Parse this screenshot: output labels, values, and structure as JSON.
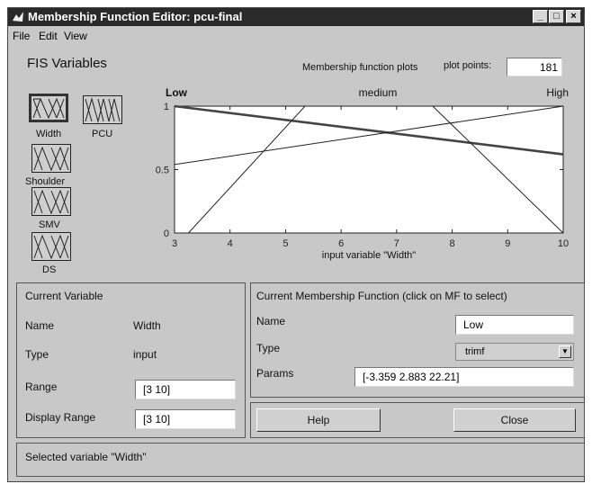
{
  "window": {
    "title": "Membership Function Editor: pcu-final",
    "minimize": "_",
    "maximize": "□",
    "close": "×"
  },
  "menu": [
    "File",
    "Edit",
    "View"
  ],
  "fis": {
    "label": "FIS Variables",
    "variables": [
      {
        "name": "Width",
        "selected": true
      },
      {
        "name": "PCU",
        "selected": false
      },
      {
        "name": "Shoulder",
        "selected": false
      },
      {
        "name": "SMV",
        "selected": false
      },
      {
        "name": "DS",
        "selected": false
      }
    ]
  },
  "plot": {
    "title_label": "Membership function plots",
    "points_label": "plot points:",
    "points_value": "181"
  },
  "chart_data": {
    "type": "line",
    "xlabel": "input variable \"Width\"",
    "xlim": [
      3,
      10
    ],
    "ylim": [
      0,
      1
    ],
    "xticks": [
      "3",
      "4",
      "5",
      "6",
      "7",
      "8",
      "9",
      "10"
    ],
    "yticks": [
      "0",
      "0.5",
      "1"
    ],
    "series": [
      {
        "name": "Low",
        "points": [
          [
            3,
            1
          ],
          [
            10,
            0.62
          ]
        ],
        "bold": true
      },
      {
        "name": "medium",
        "points": [
          [
            3,
            0
          ],
          [
            3.25,
            0
          ],
          [
            5.35,
            1
          ],
          [
            7.65,
            1
          ],
          [
            10,
            0
          ]
        ],
        "bold": false
      },
      {
        "name": "High",
        "points": [
          [
            3,
            0.54
          ],
          [
            10,
            1
          ]
        ],
        "bold": false
      }
    ]
  },
  "current_variable": {
    "header": "Current Variable",
    "name_label": "Name",
    "name_value": "Width",
    "type_label": "Type",
    "type_value": "input",
    "range_label": "Range",
    "range_value": "[3 10]",
    "display_range_label": "Display Range",
    "display_range_value": "[3 10]"
  },
  "current_mf": {
    "header": "Current Membership Function (click on MF to select)",
    "name_label": "Name",
    "name_value": "Low",
    "type_label": "Type",
    "type_value": "trimf",
    "params_label": "Params",
    "params_value": "[-3.359 2.883 22.21]"
  },
  "buttons": {
    "help": "Help",
    "close": "Close"
  },
  "status": "Selected variable \"Width\""
}
